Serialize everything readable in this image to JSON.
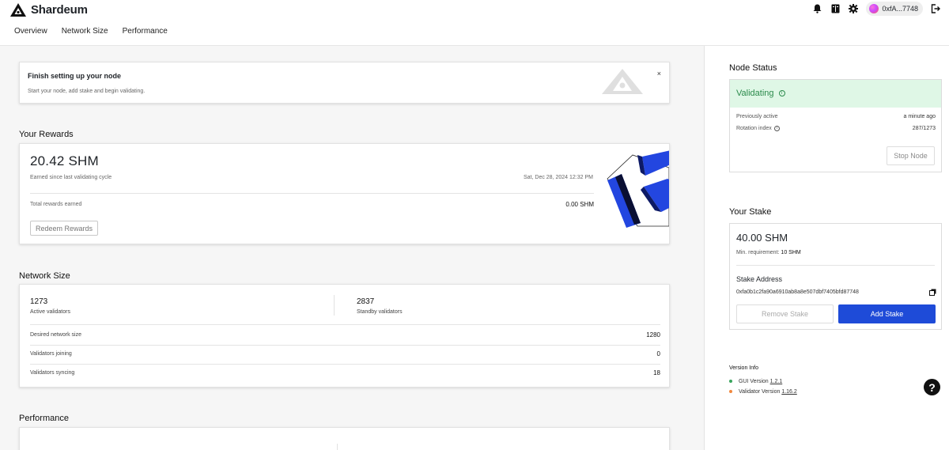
{
  "header": {
    "brand": "Shardeum",
    "nav": [
      "Overview",
      "Network Size",
      "Performance"
    ],
    "wallet_address": "0xfA...7748"
  },
  "setup": {
    "title": "Finish setting up your node",
    "description": "Start your node, add stake and begin validating.",
    "close": "×"
  },
  "rewards": {
    "heading": "Your Rewards",
    "amount": "20.42 SHM",
    "earned_label": "Earned since last validating cycle",
    "timestamp": "Sat, Dec 28, 2024 12:32 PM",
    "total_label": "Total rewards earned",
    "total_value": "0.00 SHM",
    "redeem_label": "Redeem Rewards"
  },
  "network": {
    "heading": "Network Size",
    "active_count": "1273",
    "active_label": "Active validators",
    "standby_count": "2837",
    "standby_label": "Standby validators",
    "rows": [
      {
        "label": "Desired network size",
        "value": "1280"
      },
      {
        "label": "Validators joining",
        "value": "0"
      },
      {
        "label": "Validators syncing",
        "value": "18"
      }
    ]
  },
  "performance": {
    "heading": "Performance"
  },
  "node_status": {
    "heading": "Node Status",
    "status": "Validating",
    "prev_active_label": "Previously active",
    "prev_active_value": "a minute ago",
    "rotation_label": "Rotation index",
    "rotation_value": "287/1273",
    "stop_label": "Stop Node"
  },
  "stake": {
    "heading": "Your Stake",
    "amount": "40.00 SHM",
    "min_req_label": "Min. requirement:",
    "min_req_value": "10 SHM",
    "address_label": "Stake Address",
    "address": "0xfa0b1c2fa90a6910ab8a8e507dbf7405bfd87748",
    "remove_label": "Remove Stake",
    "add_label": "Add Stake"
  },
  "version": {
    "heading": "Version Info",
    "gui_label": "GUI Version",
    "gui_value": "1.2.1",
    "validator_label": "Validator Version",
    "validator_value": "1.16.2"
  },
  "colors": {
    "accent_blue": "#1e4bd8",
    "status_green": "#2a8a4b",
    "status_bg": "#dff7e6",
    "dot_green": "#3aa55d",
    "dot_orange": "#f0883e"
  },
  "icons": [
    "shardeum-logo-icon",
    "bell-icon",
    "book-icon",
    "gear-icon",
    "logout-icon",
    "info-icon",
    "copy-icon",
    "help-icon",
    "close-icon"
  ]
}
